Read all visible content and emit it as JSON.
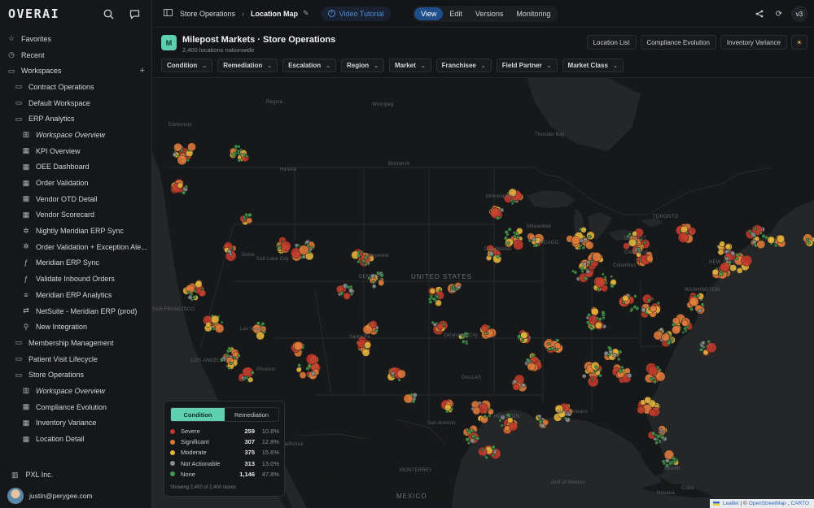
{
  "logo": "OVERAI",
  "sidebar": {
    "items": [
      {
        "label": "Favorites",
        "icon": "star-icon",
        "glyph": "☆",
        "level": 0
      },
      {
        "label": "Recent",
        "icon": "clock-icon",
        "glyph": "◷",
        "level": 0
      },
      {
        "label": "Workspaces",
        "icon": "folder-icon",
        "glyph": "▭",
        "level": 0,
        "plus": "+"
      },
      {
        "label": "Contract Operations",
        "icon": "folder-icon",
        "glyph": "▭",
        "level": 1
      },
      {
        "label": "Default Workspace",
        "icon": "folder-icon",
        "glyph": "▭",
        "level": 1
      },
      {
        "label": "ERP Analytics",
        "icon": "folder-open-icon",
        "glyph": "▭",
        "level": 1
      },
      {
        "label": "Workspace Overview",
        "icon": "book-icon",
        "glyph": "▥",
        "level": 2,
        "italic": true
      },
      {
        "label": "KPI Overview",
        "icon": "dashboard-icon",
        "glyph": "▦",
        "level": 2
      },
      {
        "label": "OEE Dashboard",
        "icon": "dashboard-icon",
        "glyph": "▦",
        "level": 2
      },
      {
        "label": "Order Validation",
        "icon": "dashboard-icon",
        "glyph": "▦",
        "level": 2
      },
      {
        "label": "Vendor OTD Detail",
        "icon": "dashboard-icon",
        "glyph": "▦",
        "level": 2
      },
      {
        "label": "Vendor Scorecard",
        "icon": "dashboard-icon",
        "glyph": "▦",
        "level": 2
      },
      {
        "label": "Nightly Meridian ERP Sync",
        "icon": "automation-icon",
        "glyph": "✲",
        "level": 2
      },
      {
        "label": "Order Validation + Exception Ale...",
        "icon": "automation-icon",
        "glyph": "✲",
        "level": 2
      },
      {
        "label": "Meridian ERP Sync",
        "icon": "function-icon",
        "glyph": "ƒ",
        "level": 2
      },
      {
        "label": "Validate Inbound Orders",
        "icon": "function-icon",
        "glyph": "ƒ",
        "level": 2
      },
      {
        "label": "Meridian ERP Analytics",
        "icon": "database-icon",
        "glyph": "≡",
        "level": 2
      },
      {
        "label": "NetSuite - Meridian ERP (prod)",
        "icon": "connector-icon",
        "glyph": "⇄",
        "level": 2
      },
      {
        "label": "New Integration",
        "icon": "plug-icon",
        "glyph": "⚲",
        "level": 2
      },
      {
        "label": "Membership Management",
        "icon": "folder-icon",
        "glyph": "▭",
        "level": 1
      },
      {
        "label": "Patient Visit Lifecycle",
        "icon": "folder-icon",
        "glyph": "▭",
        "level": 1
      },
      {
        "label": "Store Operations",
        "icon": "folder-open-icon",
        "glyph": "▭",
        "level": 1
      },
      {
        "label": "Workspace Overview",
        "icon": "book-icon",
        "glyph": "▥",
        "level": 2,
        "italic": true
      },
      {
        "label": "Compliance Evolution",
        "icon": "dashboard-icon",
        "glyph": "▦",
        "level": 2
      },
      {
        "label": "Inventory Variance",
        "icon": "dashboard-icon",
        "glyph": "▦",
        "level": 2
      },
      {
        "label": "Location Detail",
        "icon": "dashboard-icon",
        "glyph": "▦",
        "level": 2
      }
    ],
    "org": "PXL Inc.",
    "user_email": "justin@perygee.com"
  },
  "topbar": {
    "breadcrumb_parent": "Store Operations",
    "breadcrumb_sep": "›",
    "breadcrumb_current": "Location Map",
    "video_label": "Video Tutorial",
    "modes": [
      "View",
      "Edit",
      "Versions",
      "Monitoring"
    ],
    "active_mode": "View",
    "version": "v3"
  },
  "header": {
    "badge": "M",
    "title": "Milepost Markets · Store Operations",
    "subtitle": "2,400 locations nationwide",
    "links": [
      "Location List",
      "Compliance Evolution",
      "Inventory Variance"
    ],
    "filters": [
      "Condition",
      "Remediation",
      "Escalation",
      "Region",
      "Market",
      "Franchisee",
      "Field Partner",
      "Market Class"
    ]
  },
  "map": {
    "labels": [
      {
        "text": "UNITED STATES",
        "kind": "country"
      },
      {
        "text": "MEXICO",
        "kind": "country"
      },
      {
        "text": "Edmonton"
      },
      {
        "text": "Regina"
      },
      {
        "text": "Winnipeg"
      },
      {
        "text": "Thunder Bay"
      },
      {
        "text": "Helena"
      },
      {
        "text": "Bismarck"
      },
      {
        "text": "Minneapolis"
      },
      {
        "text": "Milwaukee"
      },
      {
        "text": "CHICAGO"
      },
      {
        "text": "DETROIT"
      },
      {
        "text": "TORONTO"
      },
      {
        "text": "Boise"
      },
      {
        "text": "Salt Lake City"
      },
      {
        "text": "Cheyenne"
      },
      {
        "text": "DENVER"
      },
      {
        "text": "Des Moines"
      },
      {
        "text": "Columbus"
      },
      {
        "text": "Cleveland"
      },
      {
        "text": "NEW YORK"
      },
      {
        "text": "WASHINGTON"
      },
      {
        "text": "SAN FRANCISCO"
      },
      {
        "text": "Las Vegas"
      },
      {
        "text": "LOS ANGELES"
      },
      {
        "text": "Phoenix"
      },
      {
        "text": "Santa Fe"
      },
      {
        "text": "Oklahoma City"
      },
      {
        "text": "DALLAS"
      },
      {
        "text": "San Antonio"
      },
      {
        "text": "HOUSTON"
      },
      {
        "text": "New Orleans"
      },
      {
        "text": "MONTERREY"
      },
      {
        "text": "Gulf of Mexico"
      },
      {
        "text": "Golfo de California"
      },
      {
        "text": "MIAMI"
      },
      {
        "text": "Cuba"
      },
      {
        "text": "Havana"
      }
    ],
    "attribution": {
      "leaflet": "Leaflet",
      "sep": "| ©",
      "osm": "OpenStreetMap",
      "carto": "CARTO"
    }
  },
  "legend": {
    "tabs": [
      "Condition",
      "Remediation"
    ],
    "active_tab": "Condition",
    "rows": [
      {
        "name": "Severe",
        "count": "259",
        "pct": "10.8%",
        "color": "#c0392b"
      },
      {
        "name": "Significant",
        "count": "307",
        "pct": "12.8%",
        "color": "#e07a3a"
      },
      {
        "name": "Moderate",
        "count": "375",
        "pct": "15.6%",
        "color": "#e3b43c"
      },
      {
        "name": "Not Actionable",
        "count": "313",
        "pct": "13.0%",
        "color": "#8a8d93"
      },
      {
        "name": "None",
        "count": "1,146",
        "pct": "47.8%",
        "color": "#3f9a4a"
      }
    ],
    "footer": "Showing 2,400 of 2,400 stores"
  }
}
